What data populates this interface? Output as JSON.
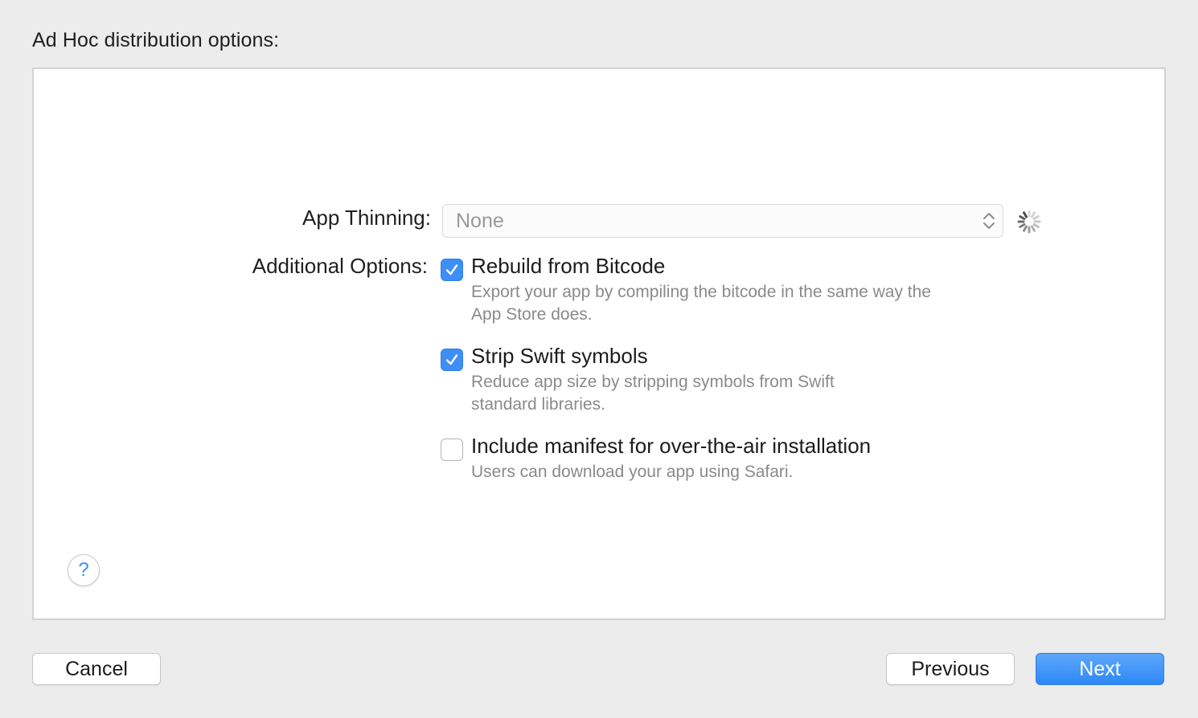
{
  "heading": "Ad Hoc distribution options:",
  "app_thinning": {
    "label": "App Thinning:",
    "selected": "None"
  },
  "additional_options": {
    "label": "Additional Options:",
    "options": [
      {
        "title": "Rebuild from Bitcode",
        "description_lines": [
          "Export your app by compiling the bitcode in the same way the",
          "App Store does."
        ],
        "checked": true
      },
      {
        "title": "Strip Swift symbols",
        "description_lines": [
          "Reduce app size by stripping symbols from Swift",
          "standard libraries."
        ],
        "checked": true
      },
      {
        "title": "Include manifest for over-the-air installation",
        "description_lines": [
          "Users can download your app using Safari."
        ],
        "checked": false
      }
    ]
  },
  "help_glyph": "?",
  "buttons": {
    "cancel": "Cancel",
    "previous": "Previous",
    "next": "Next"
  },
  "colors": {
    "accent": "#3d8ff7",
    "background": "#ececec",
    "secondary_text": "#8a8a8a"
  }
}
